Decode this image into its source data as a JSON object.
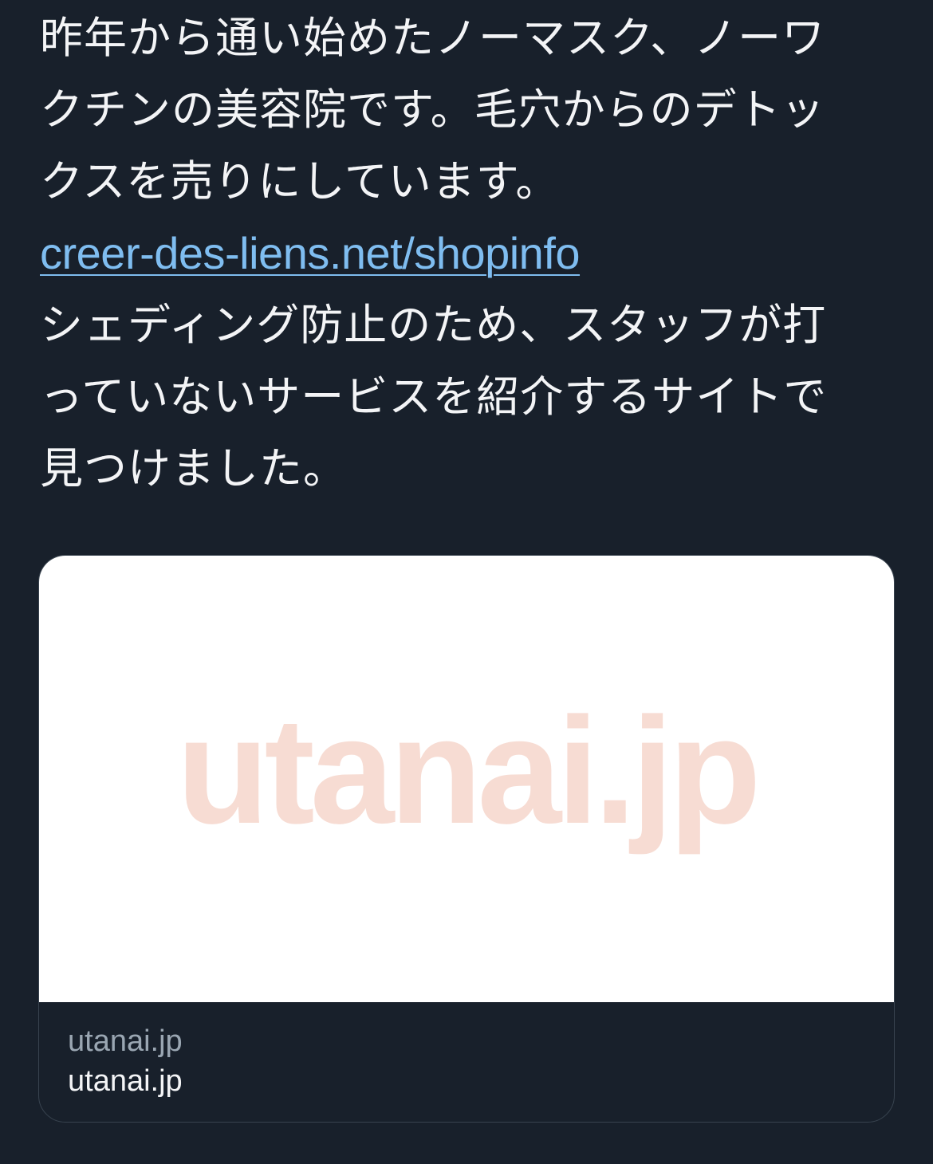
{
  "tweet": {
    "lines": [
      "昨年から通い始めたノーマスク、ノーワ",
      "クチンの美容院です。毛穴からのデトッ",
      "クスを売りにしています。"
    ],
    "link": "creer-des-liens.net/shopinfo",
    "lines_after": [
      "シェディング防止のため、スタッフが打",
      "っていないサービスを紹介するサイトで",
      "見つけました。"
    ]
  },
  "card": {
    "image_text": "utanai.jp",
    "image_text_color": "#f7dcd3",
    "domain": "utanai.jp",
    "title": "utanai.jp"
  },
  "colors": {
    "background": "#18202b",
    "text": "#f3f4f6",
    "link": "#7fbdf0",
    "muted": "#9aa6b2",
    "card_border": "#38434f"
  }
}
